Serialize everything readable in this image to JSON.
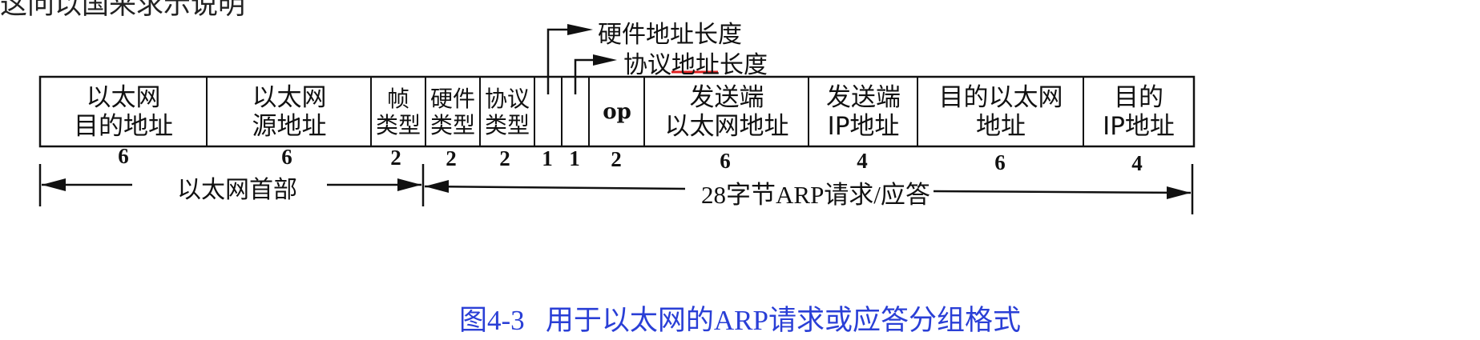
{
  "top_partial_text": "这问以国来求示说明",
  "field_labels": {
    "hw_addr_len": "硬件地址长度",
    "proto_addr_len": "协议地址长度"
  },
  "fields": [
    {
      "label": "以太网\n目的地址",
      "bytes": "6"
    },
    {
      "label": "以太网\n源地址",
      "bytes": "6"
    },
    {
      "label": "帧\n类型",
      "bytes": "2"
    },
    {
      "label": "硬件\n类型",
      "bytes": "2"
    },
    {
      "label": "协议\n类型",
      "bytes": "2"
    },
    {
      "label": "",
      "bytes": "1"
    },
    {
      "label": "",
      "bytes": "1"
    },
    {
      "label": "op",
      "bytes": "2"
    },
    {
      "label": "发送端\n以太网地址",
      "bytes": "6"
    },
    {
      "label": "发送端\nIP地址",
      "bytes": "4"
    },
    {
      "label": "目的以太网\n地址",
      "bytes": "6"
    },
    {
      "label": "目的\nIP地址",
      "bytes": "4"
    }
  ],
  "spans": {
    "ethernet_header": "以太网首部",
    "arp_body": "28字节ARP请求/应答"
  },
  "caption": "图4-3   用于以太网的ARP请求或应答分组格式",
  "colors": {
    "caption": "#2a3fd6",
    "underline": "#e02020",
    "line": "#111111"
  }
}
